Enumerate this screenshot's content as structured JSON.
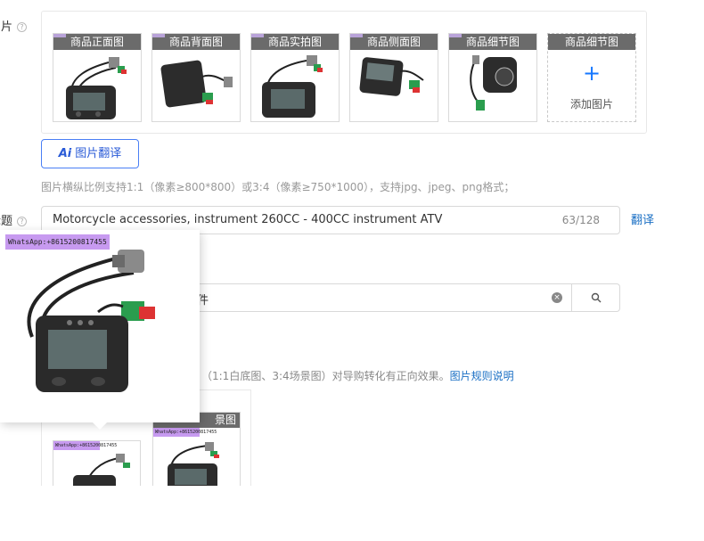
{
  "image_section": {
    "label": "图片",
    "slots": [
      {
        "label": "商品正面图"
      },
      {
        "label": "商品背面图"
      },
      {
        "label": "商品实拍图"
      },
      {
        "label": "商品侧面图"
      },
      {
        "label": "商品细节图"
      }
    ],
    "add_slot": {
      "label": "商品细节图",
      "plus": "+",
      "text": "添加图片"
    },
    "ai_button": {
      "icon_text": "Ai",
      "label": "图片翻译"
    },
    "hint": "图片横纵比例支持1:1（像素≥800*800）或3:4（像素≥750*1000），支持jpg、jpeg、png格式；"
  },
  "title_section": {
    "label": "标题",
    "value": "Motorcycle accessories, instrument 260CC - 400CC instrument ATV",
    "count": "63/128",
    "translate_link": "翻译"
  },
  "category_section": {
    "value_visible": "件",
    "clear_icon": "×",
    "search_icon": "🔍"
  },
  "lower_section": {
    "hint_tail": "（1:1白底图、3:4场景图）对导购转化有正向效果。",
    "rules_link": "图片规则说明",
    "slot2_label": "景图"
  },
  "popover": {
    "watermark": "WhatsApp:+8615200817455",
    "small_watermark": "WhatsApp:+8615200817455"
  },
  "colors": {
    "accent": "#1677ff",
    "link": "#1a6fc4",
    "slot_header": "#6b6b6b",
    "watermark_bg": "#c79af0"
  }
}
